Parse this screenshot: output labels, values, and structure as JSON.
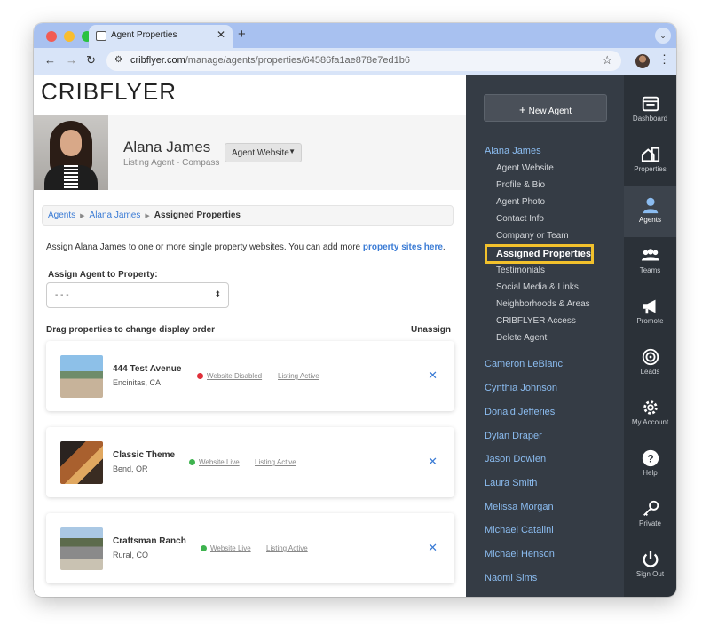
{
  "browser": {
    "tab_title": "Agent Properties",
    "tab_close": "✕",
    "new_tab": "+",
    "url_domain": "cribflyer.com",
    "url_path": "/manage/agents/properties/64586fa1ae878e7ed1b6",
    "back": "←",
    "forward": "→",
    "reload": "↻",
    "bookmark": "☆",
    "menu": "⋮",
    "tab_menu": "⌄"
  },
  "app": {
    "logo": "CRIBFLYER",
    "agent_name": "Alana James",
    "agent_subtitle": "Listing Agent - Compass",
    "website_button": "Agent Website"
  },
  "breadcrumb": {
    "items": [
      "Agents",
      "Alana James"
    ],
    "current": "Assigned Properties"
  },
  "intro": {
    "text": "Assign Alana James to one or more single property websites. You can add more ",
    "link": "property sites here",
    "end": "."
  },
  "assign": {
    "label": "Assign Agent to Property:",
    "value": "- - -"
  },
  "list": {
    "drag_label": "Drag properties to change display order",
    "unassign_label": "Unassign"
  },
  "properties": [
    {
      "title": "444 Test Avenue",
      "location": "Encinitas, CA",
      "website_status": "Website Disabled",
      "website_color": "red",
      "listing_status": "Listing Active"
    },
    {
      "title": "Classic Theme",
      "location": "Bend, OR",
      "website_status": "Website Live",
      "website_color": "green",
      "listing_status": "Listing Active"
    },
    {
      "title": "Craftsman Ranch",
      "location": "Rural, CO",
      "website_status": "Website Live",
      "website_color": "green",
      "listing_status": "Listing Active"
    }
  ],
  "sidebar": {
    "new_agent": "New Agent",
    "current_agent": "Alana James",
    "sub_items": [
      "Agent Website",
      "Profile & Bio",
      "Agent Photo",
      "Contact Info",
      "Company or Team",
      "Assigned Properties",
      "Testimonials",
      "Social Media & Links",
      "Neighborhoods & Areas",
      "CRIBFLYER Access",
      "Delete Agent"
    ],
    "active_sub_item": "Assigned Properties",
    "other_agents": [
      "Cameron LeBlanc",
      "Cynthia Johnson",
      "Donald Jefferies",
      "Dylan Draper",
      "Jason Dowlen",
      "Laura Smith",
      "Melissa Morgan",
      "Michael Catalini",
      "Michael Henson",
      "Naomi Sims"
    ]
  },
  "nav": [
    {
      "label": "Dashboard",
      "icon": "dashboard-icon"
    },
    {
      "label": "Properties",
      "icon": "properties-icon"
    },
    {
      "label": "Agents",
      "icon": "agent-icon"
    },
    {
      "label": "Teams",
      "icon": "teams-icon"
    },
    {
      "label": "Promote",
      "icon": "megaphone-icon"
    },
    {
      "label": "Leads",
      "icon": "target-icon"
    },
    {
      "label": "My Account",
      "icon": "gear-icon"
    },
    {
      "label": "Help",
      "icon": "help-icon"
    },
    {
      "label": "Private",
      "icon": "key-icon"
    },
    {
      "label": "Sign Out",
      "icon": "power-icon"
    }
  ],
  "nav_active": "Agents",
  "colors": {
    "accent_link": "#3a7bd5",
    "sidebar_bg": "#353c45",
    "nav_bg": "#2b3138",
    "highlight": "#f2c12c",
    "status_red": "#e0303a",
    "status_green": "#3eb34f"
  }
}
